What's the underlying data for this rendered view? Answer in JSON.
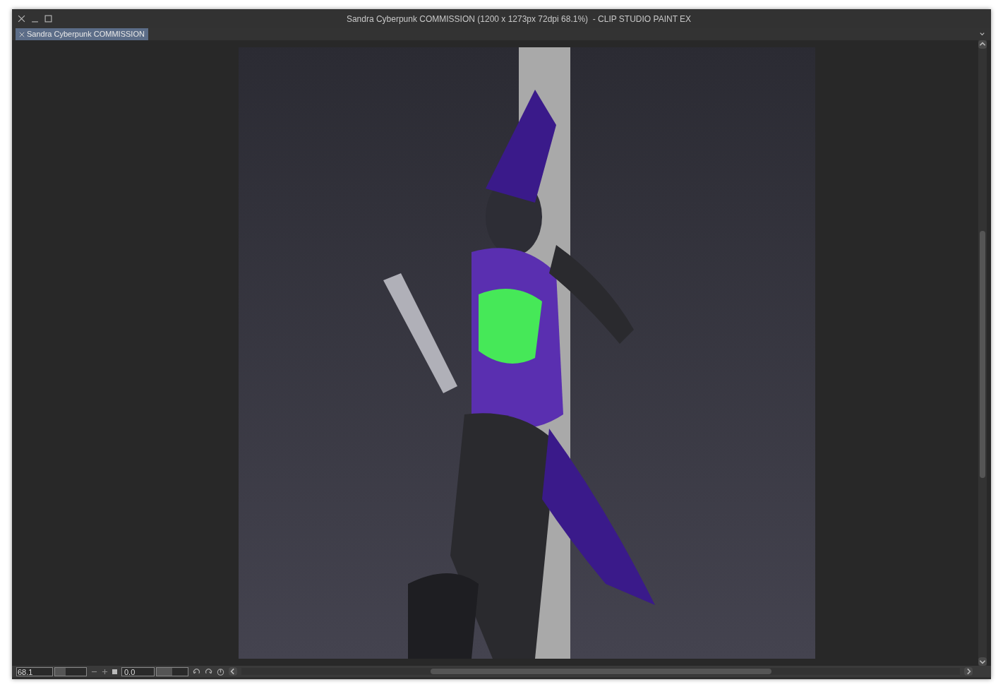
{
  "window": {
    "title": "Sandra Cyberpunk COMMISSION (1200 x 1273px 72dpi 68.1%)  - CLIP STUDIO PAINT EX"
  },
  "tabs": [
    {
      "label": "Sandra Cyberpunk COMMISSION",
      "selected": true
    }
  ],
  "status_bar": {
    "zoom": "68.1",
    "zoom_slider": {
      "level": 0.35
    },
    "rotation": "0.0",
    "rotation_slider": {
      "level": 0.5
    }
  }
}
